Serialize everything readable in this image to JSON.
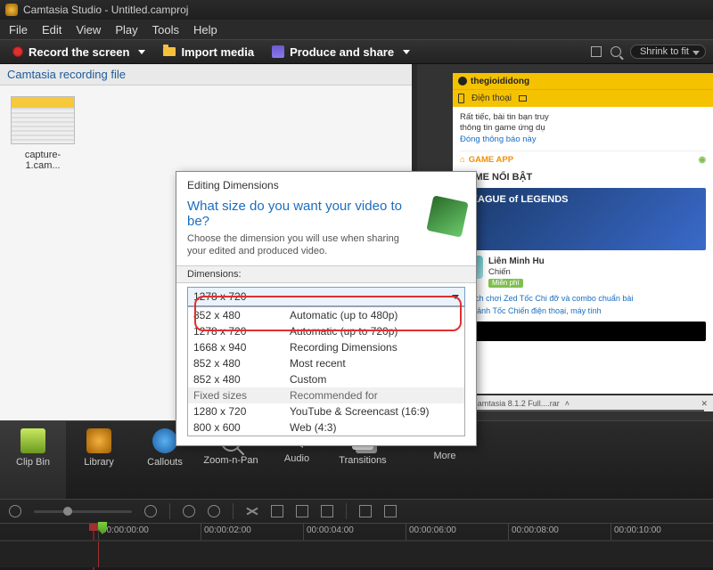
{
  "title": "Camtasia Studio - Untitled.camproj",
  "menu": {
    "file": "File",
    "edit": "Edit",
    "view": "View",
    "play": "Play",
    "tools": "Tools",
    "help": "Help"
  },
  "toolbar": {
    "record": "Record the screen",
    "import": "Import media",
    "produce": "Produce and share",
    "shrink": "Shrink to fit"
  },
  "bin": {
    "header": "Camtasia recording file",
    "thumb_caption": "capture-1.cam..."
  },
  "dialog": {
    "title": "Editing Dimensions",
    "question": "What size do you want your video to be?",
    "subtitle": "Choose the dimension you will use when sharing your edited and produced video.",
    "dim_label": "Dimensions:",
    "combo_value": "1278 x 720",
    "rows": [
      {
        "c1": "852 x 480",
        "c2": "Automatic (up to 480p)"
      },
      {
        "c1": "1278 x 720",
        "c2": "Automatic (up to 720p)"
      },
      {
        "c1": "1668 x 940",
        "c2": "Recording Dimensions"
      },
      {
        "c1": "852 x 480",
        "c2": "Most recent"
      },
      {
        "c1": "852 x 480",
        "c2": "Custom"
      },
      {
        "c1": "Fixed sizes",
        "c2": "Recommended for",
        "hdr": true
      },
      {
        "c1": "1280 x 720",
        "c2": "YouTube & Screencast (16:9)"
      },
      {
        "c1": "800 x 600",
        "c2": "Web (4:3)"
      }
    ]
  },
  "preview_site": {
    "brand": "thegioididong",
    "tab1": "Điện thoại",
    "body1": "Rất tiếc, bài tin bạn truy",
    "body2": "thông tin game ứng dụ",
    "body3": "Đóng thông báo này",
    "gameapp": "GAME APP",
    "section": "GAME NỔI BẬT",
    "hero": "LEAGUE of LEGENDS",
    "app_name": "Liên Minh Hu",
    "app_sub": "Chiến",
    "app_badge": "Miễn phí",
    "li1": "Cách chơi Zed Tốc Chi đỡ và combo chuẩn bài",
    "li2": "Bộ ảnh Tốc Chiến điện thoại, máy tính",
    "download": "Camtasia 8.1.2 Full....rar"
  },
  "tabs": {
    "clipbin": "Clip Bin",
    "library": "Library",
    "callouts": "Callouts",
    "zoom": "Zoom-n-Pan",
    "audio": "Audio",
    "transitions": "Transitions",
    "more": "More"
  },
  "timeline": {
    "times": [
      "00:00:00:00",
      "00:00:02:00",
      "00:00:04:00",
      "00:00:06:00",
      "00:00:08:00",
      "00:00:10:00"
    ]
  }
}
